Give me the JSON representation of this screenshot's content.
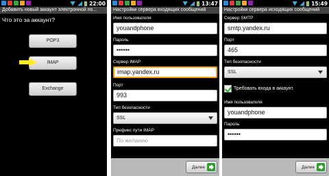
{
  "screens": [
    {
      "status_time": "22:00",
      "title": "Добавить новый аккаунт электронной по...",
      "question": "Что это за аккаунт?",
      "buttons": [
        "POP3",
        "IMAP",
        "Exchange"
      ]
    },
    {
      "status_time": "13:47",
      "title": "Настройки сервера входящих сообщений",
      "username_label": "Имя пользователя",
      "username_value": "youandphone",
      "password_label": "Пароль",
      "password_value": "••••••",
      "server_label": "Сервер IMAP",
      "server_value": "imap.yandex.ru",
      "port_label": "Порт",
      "port_value": "993",
      "security_label": "Тип безопасности",
      "security_value": "SSL",
      "prefix_label": "Префикс пути IMAP",
      "prefix_placeholder": "По желанию",
      "next_label": "Далее"
    },
    {
      "status_time": "15:49",
      "title": "Настройки сервера исходящих сообщений",
      "server_label": "Сервер SMTP",
      "server_value": "smtp.yandex.ru",
      "port_label": "Порт",
      "port_value": "465",
      "security_label": "Тип безопасности",
      "security_value": "SSL",
      "auth_label": "Требовать входа в аккаунт.",
      "username_label": "Имя пользователя",
      "username_value": "youandphone",
      "password_label": "Пароль",
      "password_value": "••••••",
      "next_label": "Далее"
    }
  ],
  "icons": {
    "status_colors": [
      "#2e8bd8",
      "#e53935",
      "#43a047",
      "#f9a825",
      "#8e24aa"
    ]
  }
}
